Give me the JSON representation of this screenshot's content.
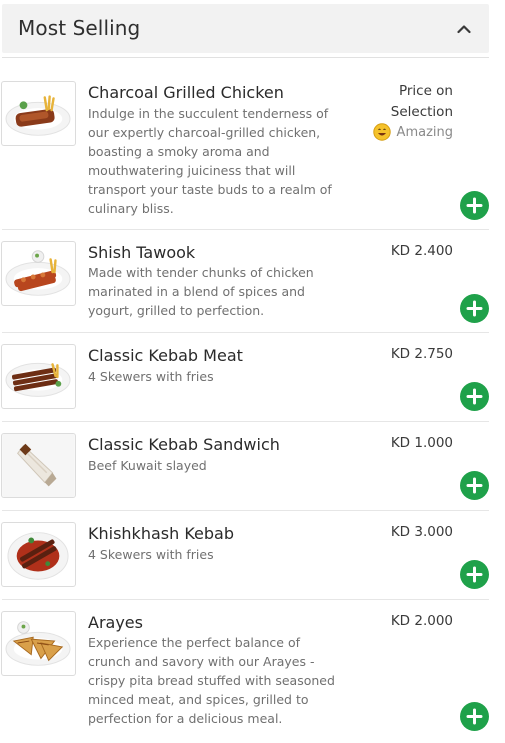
{
  "section": {
    "title": "Most Selling",
    "collapse_icon": "chevron-up-icon"
  },
  "colors": {
    "header_bg": "#f2f2f2",
    "add_button": "#1fa14a",
    "price_text": "#3a3a3a",
    "desc_text": "#707070"
  },
  "items": [
    {
      "name": "Charcoal Grilled Chicken",
      "description": "Indulge in the succulent tenderness of our expertly charcoal-grilled chicken, boasting a smoky aroma and mouthwatering juiciness that will transport your taste buds to a realm of culinary bliss.",
      "price_line1": "Price on",
      "price_line2": "Selection",
      "tag": "Amazing",
      "tag_icon": "smiley-face-icon",
      "add_icon": "plus-icon"
    },
    {
      "name": "Shish Tawook",
      "description": "Made with tender chunks of chicken marinated in a blend of spices and yogurt, grilled to perfection.",
      "price": "KD 2.400",
      "add_icon": "plus-icon"
    },
    {
      "name": "Classic Kebab Meat",
      "description": "4 Skewers with fries",
      "price": "KD 2.750",
      "add_icon": "plus-icon"
    },
    {
      "name": "Classic Kebab Sandwich",
      "description": "Beef Kuwait slayed",
      "price": "KD 1.000",
      "add_icon": "plus-icon"
    },
    {
      "name": "Khishkhash Kebab",
      "description": "4 Skewers with fries",
      "price": "KD 3.000",
      "add_icon": "plus-icon"
    },
    {
      "name": "Arayes",
      "description": "Experience the perfect balance of crunch and savory with our Arayes - crispy pita bread stuffed with seasoned minced meat, and spices, grilled to perfection for a delicious meal.",
      "price": "KD 2.000",
      "add_icon": "plus-icon"
    }
  ]
}
